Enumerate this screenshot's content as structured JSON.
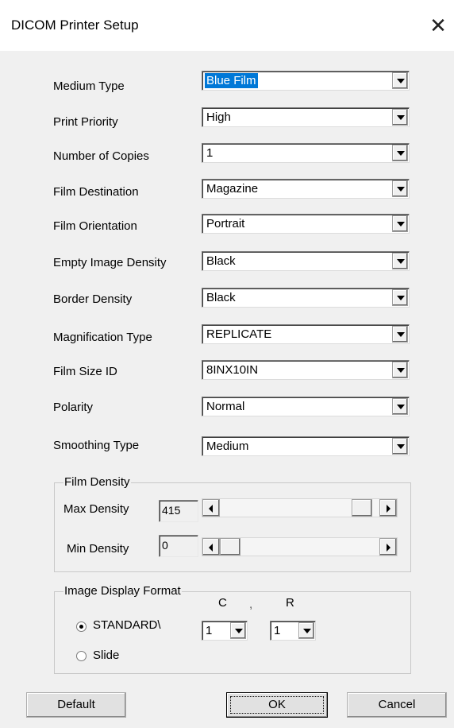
{
  "window": {
    "title": "DICOM Printer Setup",
    "close_glyph": "✕"
  },
  "fields": [
    {
      "label": "Medium Type",
      "value": "Blue Film"
    },
    {
      "label": "Print Priority",
      "value": "High"
    },
    {
      "label": "Number of Copies",
      "value": "1"
    },
    {
      "label": "Film Destination",
      "value": "Magazine"
    },
    {
      "label": "Film Orientation",
      "value": "Portrait"
    },
    {
      "label": "Empty Image Density",
      "value": "Black"
    },
    {
      "label": "Border Density",
      "value": "Black"
    },
    {
      "label": "Magnification Type",
      "value": "REPLICATE"
    },
    {
      "label": "Film Size ID",
      "value": "8INX10IN"
    },
    {
      "label": "Polarity",
      "value": "Normal"
    },
    {
      "label": "Smoothing Type",
      "value": "Medium"
    }
  ],
  "film_density": {
    "title": "Film Density",
    "max": {
      "label": "Max Density",
      "value": "415",
      "slider_fraction": 0.95
    },
    "min": {
      "label": "Min Density",
      "value": "0",
      "slider_fraction": 0.0
    }
  },
  "image_display_format": {
    "title": "Image Display Format",
    "col_header": "C",
    "separator": ",",
    "row_header": "R",
    "options": [
      {
        "label": "STANDARD\\",
        "checked": true
      },
      {
        "label": "Slide",
        "checked": false
      }
    ],
    "columns_value": "1",
    "rows_value": "1"
  },
  "buttons": {
    "default": "Default",
    "ok": "OK",
    "cancel": "Cancel"
  }
}
